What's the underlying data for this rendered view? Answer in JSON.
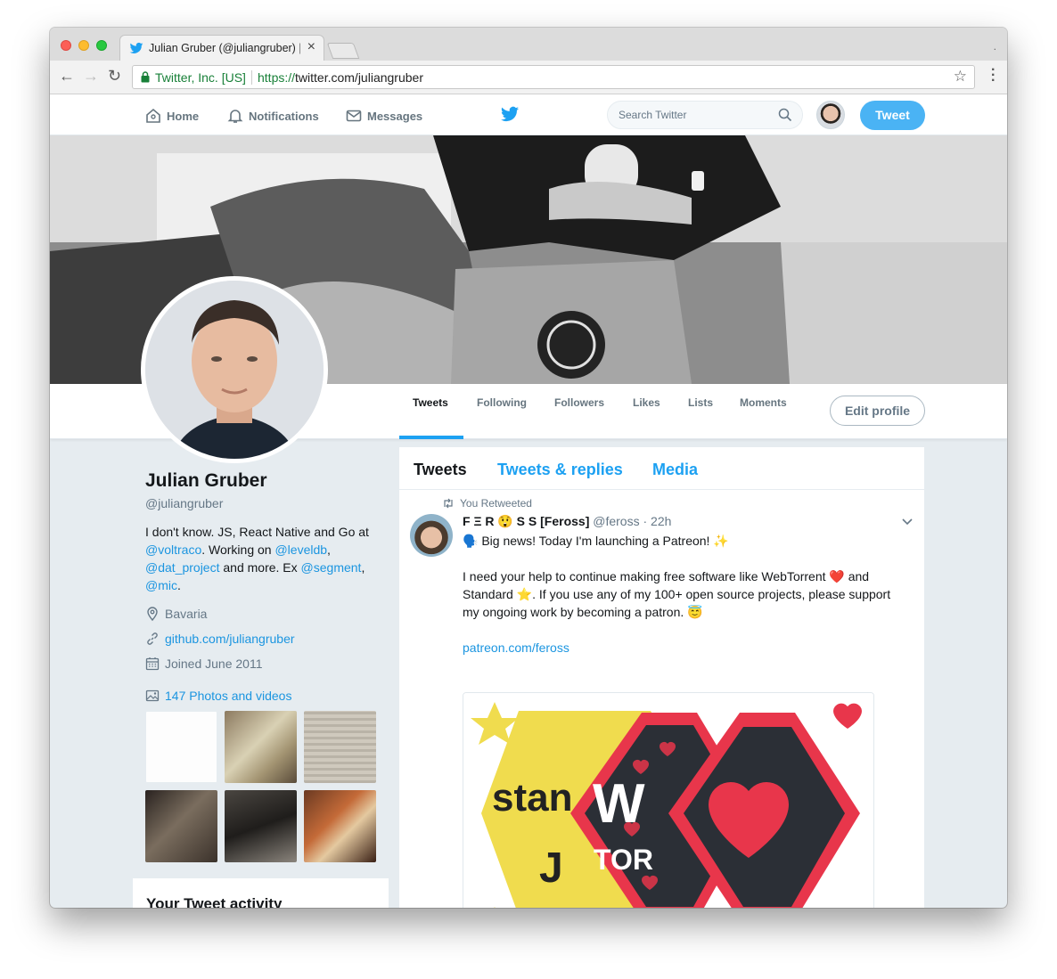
{
  "browser": {
    "tab_title": "Julian Gruber (@juliangruber) |",
    "site_identity": "Twitter, Inc. [US]",
    "url_scheme": "https://",
    "url_rest": "twitter.com/juliangruber"
  },
  "nav": {
    "home": "Home",
    "notifications": "Notifications",
    "messages": "Messages",
    "search_placeholder": "Search Twitter",
    "tweet_button": "Tweet"
  },
  "profile_nav": {
    "items": [
      "Tweets",
      "Following",
      "Followers",
      "Likes",
      "Lists",
      "Moments"
    ],
    "edit_profile": "Edit profile"
  },
  "profile": {
    "name": "Julian Gruber",
    "handle": "@juliangruber",
    "bio_1": "I don't know. JS, React Native and Go at ",
    "bio_mention_1": "@voltraco",
    "bio_2": ". Working on ",
    "bio_mention_2": "@leveldb",
    "bio_3": ", ",
    "bio_mention_3": "@dat_project",
    "bio_4": " and more. Ex ",
    "bio_mention_4": "@segment",
    "bio_5": ", ",
    "bio_mention_5": "@mic",
    "bio_6": ".",
    "location": "Bavaria",
    "website": "github.com/juliangruber",
    "joined": "Joined June 2011",
    "photos_link": "147 Photos and videos"
  },
  "activity": {
    "title": "Your Tweet activity"
  },
  "timeline": {
    "tabs": [
      "Tweets",
      "Tweets & replies",
      "Media"
    ]
  },
  "tweet": {
    "retweet_label": "You Retweeted",
    "author_display": "F Ξ R 😲 S S",
    "author_bracket": "[Feross]",
    "author_handle": "@feross",
    "time": "· 22h",
    "line1": "🗣️ Big news! Today I'm launching a Patreon! ✨",
    "line2": "I need your help to continue making free software like WebTorrent ❤️ and Standard ⭐. If you use any of my 100+ open source projects, please support my ongoing work by becoming a patron. 😇",
    "link": "patreon.com/feross",
    "card_text_1": "stan",
    "card_text_2": "J",
    "card_text_3": "W",
    "card_text_4": "TOR"
  },
  "colors": {
    "twitter_blue": "#1da1f2",
    "tweet_button": "#4ab3f4",
    "link_blue": "#1b95e0",
    "heart_red": "#e8364b",
    "standard_yellow": "#f0dc4e"
  },
  "icons": [
    "twitter-bird-icon",
    "home-icon",
    "bell-icon",
    "envelope-icon",
    "search-icon",
    "lock-icon",
    "star-icon",
    "location-icon",
    "link-icon",
    "calendar-icon",
    "photo-icon",
    "retweet-icon",
    "chevron-down-icon"
  ]
}
